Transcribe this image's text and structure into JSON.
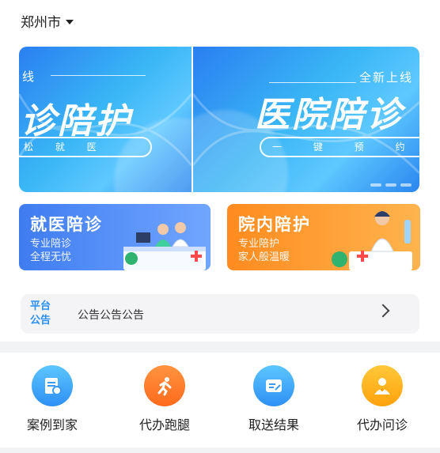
{
  "header": {
    "city": "郑州市"
  },
  "banners": [
    {
      "small": "线",
      "big": "诊陪护",
      "pill": "松 就 医"
    },
    {
      "small": "全新上线",
      "big": "医院陪诊",
      "pill": "一 键 预 约 轻"
    }
  ],
  "services": [
    {
      "title": "就医陪诊",
      "line1": "专业陪诊",
      "line2": "全程无忧",
      "color": "#4a86f2"
    },
    {
      "title": "院内陪护",
      "line1": "专业陪护",
      "line2": "家人般温暖",
      "color": "#ff9a2e"
    }
  ],
  "notice": {
    "tag": "平台公告",
    "text": "公告公告公告"
  },
  "tools": [
    {
      "label": "案例到家",
      "icon": "doc-home-icon"
    },
    {
      "label": "代办跑腿",
      "icon": "running-icon"
    },
    {
      "label": "取送结果",
      "icon": "report-icon"
    },
    {
      "label": "代办问诊",
      "icon": "doctor-icon"
    }
  ]
}
